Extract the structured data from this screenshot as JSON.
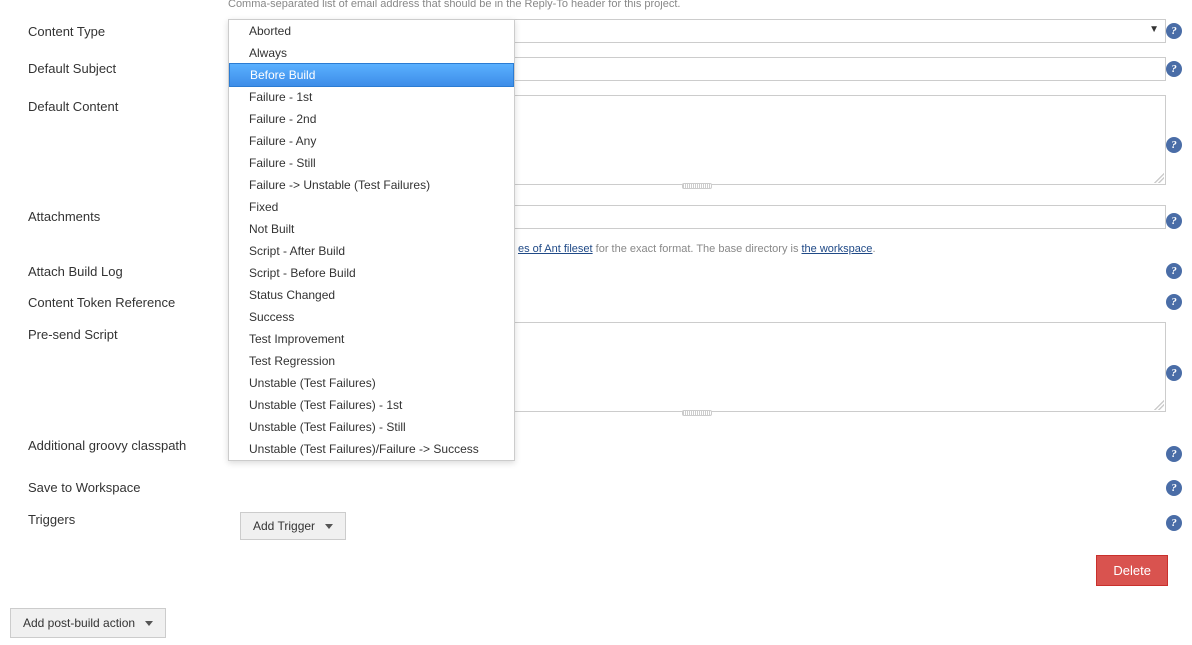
{
  "helpText": "Comma-separated list of email address that should be in the Reply-To header for this project.",
  "labels": {
    "contentType": "Content Type",
    "defaultSubject": "Default Subject",
    "defaultContent": "Default Content",
    "attachments": "Attachments",
    "attachBuildLog": "Attach Build Log",
    "contentTokenReference": "Content Token Reference",
    "preSendScript": "Pre-send Script",
    "additionalGroovyClasspath": "Additional groovy classpath",
    "saveToWorkspace": "Save to Workspace",
    "triggers": "Triggers"
  },
  "attachmentsHint": {
    "part1": "es of Ant fileset",
    "part2": " for the exact format. The base directory is ",
    "link": "the workspace",
    "part3": "."
  },
  "buttons": {
    "addTrigger": "Add Trigger",
    "addPostBuild": "Add post-build action",
    "delete": "Delete"
  },
  "triggerOptions": [
    "Aborted",
    "Always",
    "Before Build",
    "Failure - 1st",
    "Failure - 2nd",
    "Failure - Any",
    "Failure - Still",
    "Failure -> Unstable (Test Failures)",
    "Fixed",
    "Not Built",
    "Script - After Build",
    "Script - Before Build",
    "Status Changed",
    "Success",
    "Test Improvement",
    "Test Regression",
    "Unstable (Test Failures)",
    "Unstable (Test Failures) - 1st",
    "Unstable (Test Failures) - Still",
    "Unstable (Test Failures)/Failure -> Success"
  ],
  "selectedTriggerIndex": 2
}
